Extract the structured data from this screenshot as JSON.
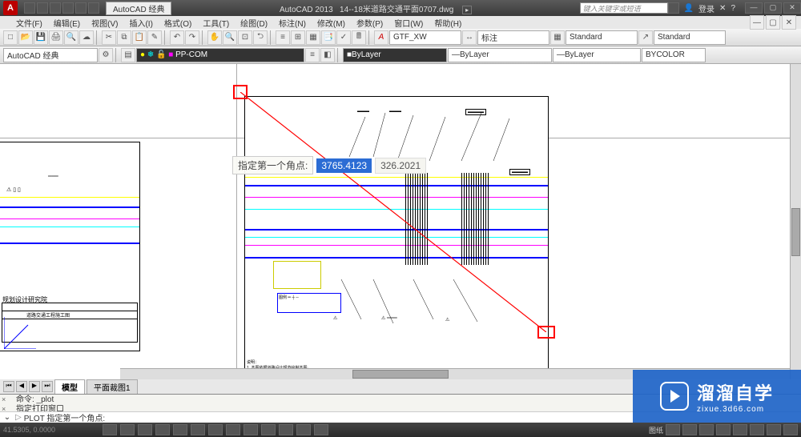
{
  "titlebar": {
    "app_logo_letter": "A",
    "workspace_label": "AutoCAD 经典",
    "app_name": "AutoCAD 2013",
    "doc_name": "14--18米道路交通平面0707.dwg",
    "search_placeholder": "键入关键字或短语",
    "login_label": "登录",
    "win_min": "—",
    "win_max": "▢",
    "win_close": "✕"
  },
  "menubar": {
    "items": [
      "文件(F)",
      "编辑(E)",
      "视图(V)",
      "插入(I)",
      "格式(O)",
      "工具(T)",
      "绘图(D)",
      "标注(N)",
      "修改(M)",
      "参数(P)",
      "窗口(W)",
      "帮助(H)"
    ]
  },
  "toolbar2": {
    "font_style": "GTF_XW",
    "dim_style": "标注",
    "std1": "Standard",
    "std2": "Standard"
  },
  "toolbar3": {
    "workspace": "AutoCAD 经典",
    "layer": "PP-COM",
    "prop1": "ByLayer",
    "prop2": "ByLayer",
    "prop3": "ByLayer",
    "prop4": "BYCOLOR"
  },
  "coord_tooltip": {
    "label": "指定第一个角点:",
    "x": "3765.4123",
    "y": "326.2021"
  },
  "frame1_title": "规划设计研究院",
  "tabs": {
    "nav": [
      "⏮",
      "◀",
      "▶",
      "⏭"
    ],
    "items": [
      "模型",
      "平面裁图1"
    ]
  },
  "command": {
    "line1": "命令: _plot",
    "line2": "指定打印窗口",
    "prompt_icon": "▷",
    "prompt": "PLOT 指定第一个角点:"
  },
  "statusbar": {
    "coords": "41.5305, 0.0000",
    "right_label": "图纸"
  },
  "watermark": {
    "main": "溜溜自学",
    "sub": "zixue.3d66.com"
  }
}
